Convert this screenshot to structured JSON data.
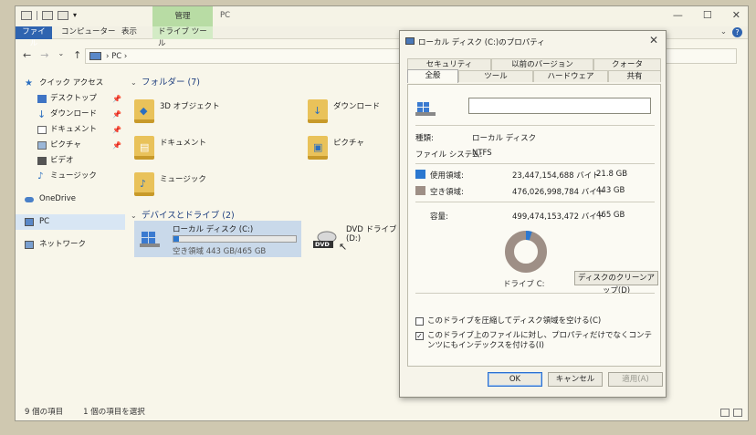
{
  "explorer": {
    "window_title": "PC",
    "context_tab": "管理",
    "ribbon_tabs": [
      "ファイル",
      "コンピューター",
      "表示",
      "ドライブ ツール"
    ],
    "address": "PC",
    "nav_pane": {
      "quick_access": "クイック アクセス",
      "items": [
        "デスクトップ",
        "ダウンロード",
        "ドキュメント",
        "ピクチャ",
        "ビデオ",
        "ミュージック"
      ],
      "onedrive": "OneDrive",
      "pc": "PC",
      "network": "ネットワーク"
    },
    "folders_header": "フォルダー (7)",
    "folders": [
      "3D オブジェクト",
      "ダウンロード",
      "ドキュメント",
      "ピクチャ",
      "ミュージック"
    ],
    "drives_header": "デバイスとドライブ (2)",
    "drive_c": {
      "name": "ローカル ディスク (C:)",
      "free": "空き領域 443 GB/465 GB",
      "used_fraction": 0.047
    },
    "drive_dvd": {
      "name": "DVD ドライブ (D:)",
      "badge": "DVD"
    },
    "status": {
      "items": "9 個の項目",
      "selected": "1 個の項目を選択"
    }
  },
  "dialog": {
    "title": "ローカル ディスク (C:)のプロパティ",
    "tabs_row1": [
      "セキュリティ",
      "以前のバージョン",
      "クォータ"
    ],
    "tabs_row2": [
      "全般",
      "ツール",
      "ハードウェア",
      "共有"
    ],
    "name_value": "",
    "type_label": "種類:",
    "type_value": "ローカル ディスク",
    "fs_label": "ファイル システム:",
    "fs_value": "NTFS",
    "used": {
      "label": "使用領域:",
      "bytes": "23,447,154,688 バイト",
      "gb": "21.8 GB",
      "color": "#2b78d0"
    },
    "free": {
      "label": "空き領域:",
      "bytes": "476,026,998,784 バイト",
      "gb": "443 GB",
      "color": "#9e8f86"
    },
    "capacity": {
      "label": "容量:",
      "bytes": "499,474,153,472 バイト",
      "gb": "465 GB"
    },
    "drive_label": "ドライブ C:",
    "cleanup_button": "ディスクのクリーンアップ(D)",
    "compress_label": "このドライブを圧縮してディスク領域を空ける(C)",
    "compress_checked": false,
    "index_label": "このドライブ上のファイルに対し、プロパティだけでなくコンテンツにもインデックスを付ける(I)",
    "index_checked": true,
    "ok": "OK",
    "cancel": "キャンセル",
    "apply": "適用(A)"
  }
}
